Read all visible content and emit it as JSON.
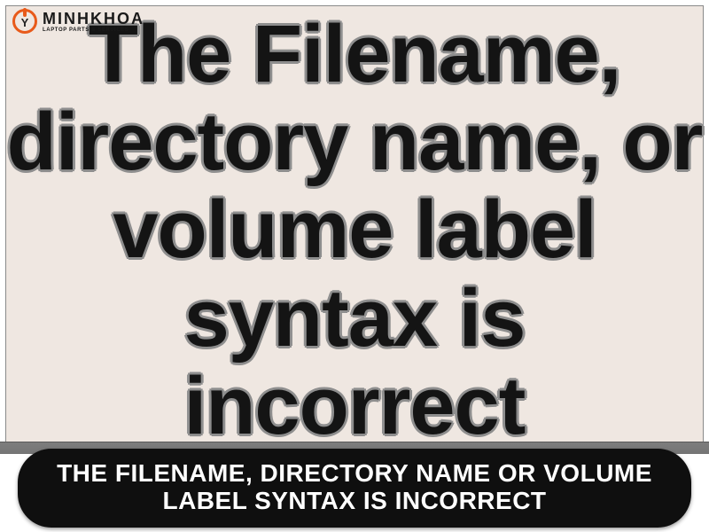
{
  "logo": {
    "brand": "MINHKHOA",
    "tagline": "LAPTOP PARTS & SERVICES",
    "glyph": "Y"
  },
  "panel": {
    "message": "The Filename,\ndirectory name, or\nvolume label syntax is\nincorrect"
  },
  "caption": {
    "text": "THE FILENAME, DIRECTORY NAME OR VOLUME LABEL SYNTAX IS INCORRECT"
  },
  "colors": {
    "panel_bg": "#efe7e1",
    "accent": "#e85a1a",
    "pill_bg": "#0f0f0f"
  }
}
